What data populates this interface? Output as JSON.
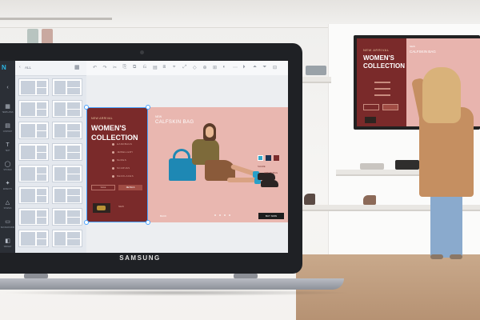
{
  "device": {
    "brand": "SAMSUNG"
  },
  "app": {
    "logo": "N",
    "rail_items": [
      {
        "icon": "‹",
        "label": ""
      },
      {
        "icon": "▦",
        "label": "TEMPLATES"
      },
      {
        "icon": "▤",
        "label": "CONTENT"
      },
      {
        "icon": "T",
        "label": "TEXT"
      },
      {
        "icon": "◯",
        "label": "STICKER"
      },
      {
        "icon": "✦",
        "label": "EFFECTS"
      },
      {
        "icon": "△",
        "label": "SHAPES"
      },
      {
        "icon": "▭",
        "label": "BACKGROUND"
      },
      {
        "icon": "◧",
        "label": "WIDGET"
      }
    ],
    "panel": {
      "back": "‹",
      "filter": "ALL"
    },
    "toolbar_icons": [
      "↶",
      "↷",
      "✂",
      "⎘",
      "⧉",
      "⎌",
      "▤",
      "⧈",
      "⌖",
      "⤢",
      "◇",
      "⊕",
      "⊞",
      "◐",
      "⋯",
      "⏵",
      "⏶",
      "⏷",
      "⊟"
    ]
  },
  "design": {
    "new_arrival": "NEW ARRIVAL",
    "title": "WOMEN'S COLLECTION",
    "list": [
      "HANDBAGS",
      "JEWELLERY",
      "SHOES",
      "SCARVES",
      "NECKLACES"
    ],
    "buttons": [
      "SALE",
      "DETAILS"
    ],
    "mini_caption": "NEW",
    "product_new": "NEW",
    "product_title": "CALFSKIN BAG",
    "swatch_colors": [
      "#33a7c9",
      "#1e3350",
      "#7b2c2c"
    ],
    "add_to_bag": "ADD TO BAG",
    "share": "SHARE",
    "back": "BACK",
    "buy_now": "BUY NOW"
  },
  "tv": {
    "new_arrival": "NEW ARRIVAL",
    "title": "WOMEN'S COLLECTION",
    "product_new": "NEW",
    "product_title": "CALFSKIN BAG"
  },
  "colors": {
    "accent": "#4aa3ff",
    "maroon": "#7a2a2a",
    "pink": "#e9b7b0"
  }
}
